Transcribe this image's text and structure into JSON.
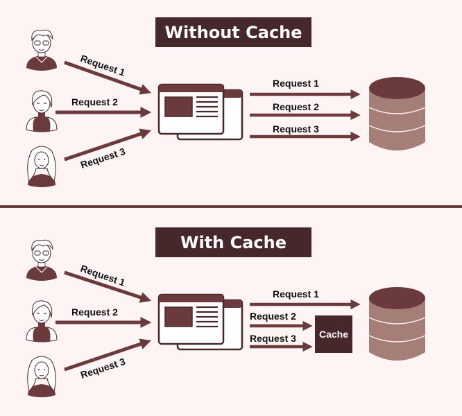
{
  "colors": {
    "background": "#fdf4f3",
    "dark": "#47282a",
    "arrow": "#6b3a3c",
    "db_body": "#a47e77",
    "db_top": "#6b3a3c",
    "text": "#111111"
  },
  "panels": [
    {
      "title": "Without Cache",
      "users": [
        {
          "icon": "user-man-glasses-icon"
        },
        {
          "icon": "user-woman-short-hair-icon"
        },
        {
          "icon": "user-woman-long-hair-icon"
        }
      ],
      "incoming_requests": [
        "Request 1",
        "Request 2",
        "Request 3"
      ],
      "server_icon": "browser-window-icon",
      "outgoing_requests": [
        {
          "label": "Request 1",
          "target": "database"
        },
        {
          "label": "Request 2",
          "target": "database"
        },
        {
          "label": "Request 3",
          "target": "database"
        }
      ],
      "database_icon": "database-icon"
    },
    {
      "title": "With Cache",
      "users": [
        {
          "icon": "user-man-glasses-icon"
        },
        {
          "icon": "user-woman-short-hair-icon"
        },
        {
          "icon": "user-woman-long-hair-icon"
        }
      ],
      "incoming_requests": [
        "Request 1",
        "Request 2",
        "Request 3"
      ],
      "server_icon": "browser-window-icon",
      "outgoing_requests": [
        {
          "label": "Request 1",
          "target": "database"
        },
        {
          "label": "Request 2",
          "target": "cache"
        },
        {
          "label": "Request 3",
          "target": "cache"
        }
      ],
      "cache_label": "Cache",
      "database_icon": "database-icon"
    }
  ]
}
